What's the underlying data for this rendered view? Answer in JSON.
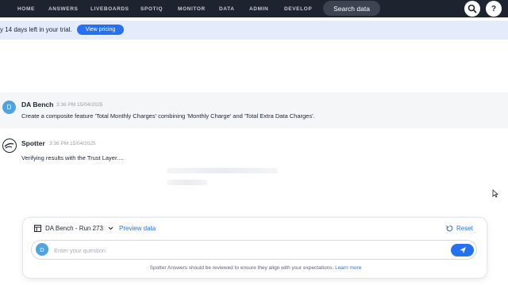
{
  "nav": {
    "items": [
      "HOME",
      "ANSWERS",
      "LIVEBOARDS",
      "SPOTIQ",
      "MONITOR",
      "DATA",
      "ADMIN",
      "DEVELOP"
    ],
    "search_label": "Search data",
    "help_label": "?"
  },
  "banner": {
    "text": "y 14 days left in your trial.",
    "button_label": "View pricing"
  },
  "messages": {
    "user": {
      "avatar_initial": "D",
      "name": "DA Bench",
      "time": "3:36 PM 15/04/2025",
      "text": "Create a composite feature 'Total Monthly Charges' combining 'Monthly Charge' and 'Total Extra Data Charges'."
    },
    "bot": {
      "name": "Spotter",
      "time": "3:36 PM 15/04/2025",
      "text": "Verifying results with the Trust Layer...."
    }
  },
  "panel": {
    "data_source": "DA Bench - Run 273",
    "preview_label": "Preview data",
    "reset_label": "Reset",
    "input_avatar_initial": "D",
    "input_placeholder": "Enter your question",
    "disclaimer": "Spotter Answers should be reviewed to ensure they align with your expectations.",
    "learn_more": "Learn more"
  },
  "colors": {
    "nav_bg": "#1d232f",
    "accent": "#2770ef",
    "banner_bg": "#e4ecfb",
    "avatar": "#4ea3e0"
  }
}
